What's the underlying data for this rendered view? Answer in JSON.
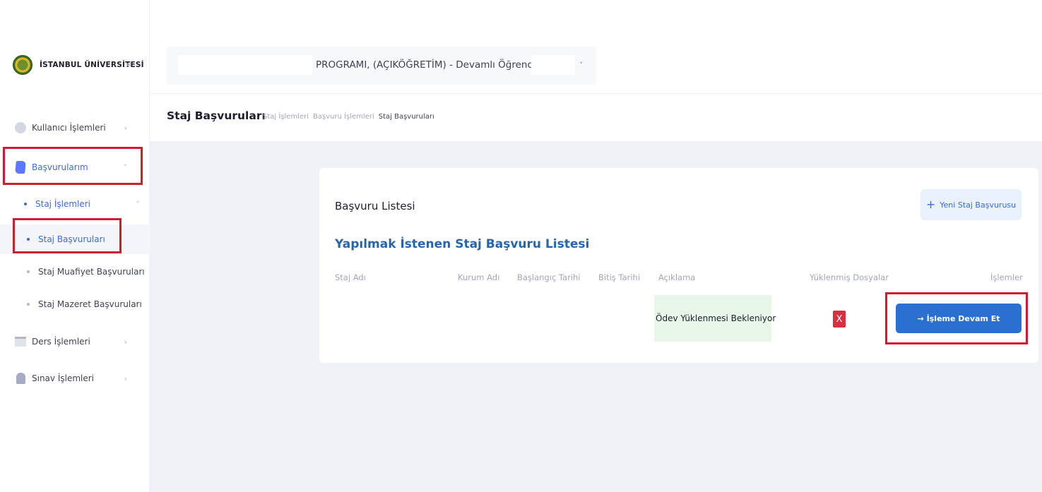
{
  "brand": {
    "name": "İSTANBUL ÜNİVERSİTESİ",
    "collapse_glyph": "«"
  },
  "sidebar": {
    "items": [
      {
        "label": "Kullanıcı İşlemleri",
        "icon": "user-icon",
        "chevron": "›"
      },
      {
        "label": "Başvurularım",
        "icon": "document-icon",
        "chevron": "˅"
      },
      {
        "label": "Ders İşlemleri",
        "icon": "book-icon",
        "chevron": "›"
      },
      {
        "label": "Sınav İşlemleri",
        "icon": "exam-icon",
        "chevron": "›"
      }
    ],
    "sub_items": [
      {
        "label": "Staj İşlemleri",
        "chevron": "˅"
      },
      {
        "label": "Staj Başvuruları"
      },
      {
        "label": "Staj Muafiyet Başvuruları"
      },
      {
        "label": "Staj Mazeret Başvuruları"
      }
    ]
  },
  "program_selector": {
    "text": "PROGRAMI, (AÇIKÖĞRETİM) - Devamlı Öğrenci",
    "chevron": "˅"
  },
  "subheader": {
    "title": "Staj Başvuruları",
    "breadcrumb": [
      "Staj İşlemleri",
      "Başvuru İşlemleri",
      "Staj Başvuruları"
    ]
  },
  "card": {
    "title": "Başvuru Listesi",
    "new_button": {
      "plus": "+",
      "label": "Yeni Staj Başvurusu"
    },
    "list_title": "Yapılmak İstenen Staj Başvuru Listesi",
    "columns": [
      "Staj Adı",
      "Kurum Adı",
      "Başlangıç Tarihi",
      "Bitiş Tarihi",
      "Açıklama",
      "Yüklenmiş Dosyalar",
      "İşlemler"
    ],
    "row": {
      "description": "Ödev Yüklenmesi Bekleniyor",
      "files_badge": "X",
      "action_arrow": "→",
      "action_label": "İşleme Devam Et"
    }
  },
  "colors": {
    "accent": "#2b6fd1",
    "highlight_border": "#cc1f2e",
    "status_bg": "#e8f5e9",
    "missing_file": "#d7303f"
  }
}
